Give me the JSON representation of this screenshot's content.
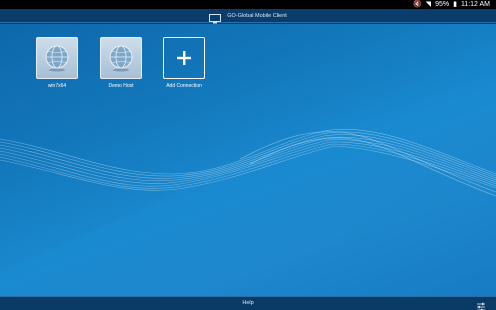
{
  "status_bar": {
    "battery": "95%",
    "time": "11:12 AM"
  },
  "title_bar": {
    "title": "GO-Global Mobile Client",
    "icon": "monitor-icon"
  },
  "connections": [
    {
      "label": "win7x64",
      "icon": "globe-icon"
    },
    {
      "label": "Demo Host",
      "icon": "globe-icon"
    },
    {
      "label": "Add Connection",
      "icon": "plus-icon"
    }
  ],
  "bottom_bar": {
    "help_label": "Help",
    "settings_icon": "sliders-icon"
  },
  "colors": {
    "background": "#1a8ad0",
    "bars": "#0a3d6b",
    "text": "#ffffff"
  }
}
